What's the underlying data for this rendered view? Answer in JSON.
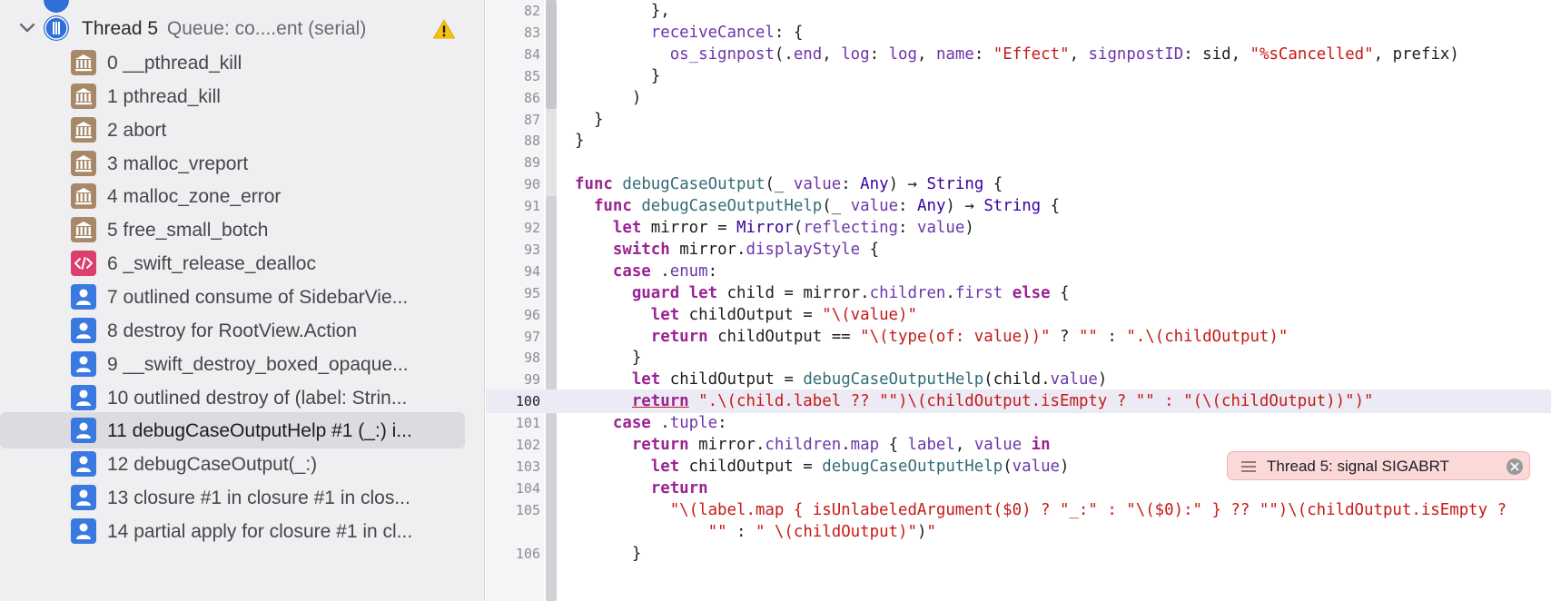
{
  "navigator": {
    "thread": {
      "name": "Thread 5",
      "queue": "Queue: co....ent (serial)",
      "icon": "thread-icon",
      "warning_icon": "warning-triangle-icon",
      "expanded": true
    },
    "frames": [
      {
        "label": "0 __pthread_kill",
        "kind": "system-library-icon"
      },
      {
        "label": "1 pthread_kill",
        "kind": "system-library-icon"
      },
      {
        "label": "2 abort",
        "kind": "system-library-icon"
      },
      {
        "label": "3 malloc_vreport",
        "kind": "system-library-icon"
      },
      {
        "label": "4 malloc_zone_error",
        "kind": "system-library-icon"
      },
      {
        "label": "5 free_small_botch",
        "kind": "system-library-icon"
      },
      {
        "label": "6 _swift_release_dealloc",
        "kind": "swift-runtime-icon"
      },
      {
        "label": "7 outlined consume of SidebarVie...",
        "kind": "user-code-icon"
      },
      {
        "label": "8 destroy for RootView.Action",
        "kind": "user-code-icon"
      },
      {
        "label": "9 __swift_destroy_boxed_opaque...",
        "kind": "user-code-icon"
      },
      {
        "label": "10 outlined destroy of (label: Strin...",
        "kind": "user-code-icon"
      },
      {
        "label": "11 debugCaseOutputHelp #1 (_:) i...",
        "kind": "user-code-icon",
        "selected": true
      },
      {
        "label": "12 debugCaseOutput(_:)",
        "kind": "user-code-icon"
      },
      {
        "label": "13 closure #1 in closure #1 in clos...",
        "kind": "user-code-icon"
      },
      {
        "label": "14 partial apply for closure #1 in cl...",
        "kind": "user-code-icon"
      }
    ]
  },
  "editor": {
    "current_line": "100",
    "lines": [
      {
        "n": "82",
        "code": "        },"
      },
      {
        "n": "83",
        "code": "        receiveCancel: {"
      },
      {
        "n": "84",
        "code": "          os_signpost(.end, log: log, name: \"Effect\", signpostID: sid, \"%sCancelled\", prefix)"
      },
      {
        "n": "85",
        "code": "        }"
      },
      {
        "n": "86",
        "code": "      )"
      },
      {
        "n": "87",
        "code": "  }"
      },
      {
        "n": "88",
        "code": "}"
      },
      {
        "n": "89",
        "code": ""
      },
      {
        "n": "90",
        "code": "func debugCaseOutput(_ value: Any) -> String {"
      },
      {
        "n": "91",
        "code": "  func debugCaseOutputHelp(_ value: Any) -> String {"
      },
      {
        "n": "92",
        "code": "    let mirror = Mirror(reflecting: value)"
      },
      {
        "n": "93",
        "code": "    switch mirror.displayStyle {"
      },
      {
        "n": "94",
        "code": "    case .enum:"
      },
      {
        "n": "95",
        "code": "      guard let child = mirror.children.first else {"
      },
      {
        "n": "96",
        "code": "        let childOutput = \"\\(value)\""
      },
      {
        "n": "97",
        "code": "        return childOutput == \"\\(type(of: value))\" ? \"\" : \".\\(childOutput)\""
      },
      {
        "n": "98",
        "code": "      }"
      },
      {
        "n": "99",
        "code": "      let childOutput = debugCaseOutputHelp(child.value)"
      },
      {
        "n": "100",
        "code": "      return \".\\(child.label ?? \"\")\\(childOutput.isEmpty ? \"\" : \"(\\(childOutput))\")\""
      },
      {
        "n": "101",
        "code": "    case .tuple:"
      },
      {
        "n": "102",
        "code": "      return mirror.children.map { label, value in"
      },
      {
        "n": "103",
        "code": "        let childOutput = debugCaseOutputHelp(value)"
      },
      {
        "n": "104",
        "code": "        return"
      },
      {
        "n": "105",
        "code": "          \"\\(label.map { isUnlabeledArgument($0) ? \"_:\" : \"\\($0):\" } ?? \"\")\\(childOutput.isEmpty ?"
      },
      {
        "n": "",
        "code": "              \"\" : \" \\(childOutput)\")\""
      },
      {
        "n": "106",
        "code": "      }"
      }
    ]
  },
  "issue": {
    "text": "Thread 5: signal SIGABRT",
    "icon": "issue-lines-icon",
    "close_icon": "close-circle-icon",
    "color": "#fbd9d9"
  },
  "colors": {
    "keyword": "#9b2393",
    "type": "#3900a0",
    "function": "#326d74",
    "property": "#6c36a9",
    "string": "#c41a16",
    "current_line_bg": "#ecebf5",
    "selected_row_bg": "#dbdbe0"
  }
}
